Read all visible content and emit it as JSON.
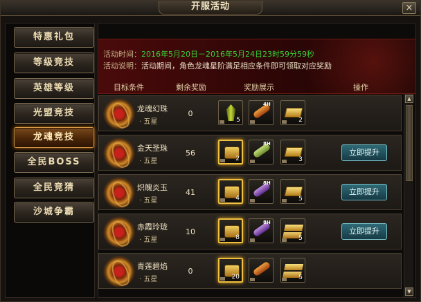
{
  "window": {
    "title": "开服活动",
    "close_glyph": "×"
  },
  "tabs": [
    {
      "id": "special-gift",
      "label": "特惠礼包",
      "active": false
    },
    {
      "id": "level-race",
      "label": "等级竞技",
      "active": false
    },
    {
      "id": "hero-level",
      "label": "英雄等级",
      "active": false
    },
    {
      "id": "alliance-race",
      "label": "光盟竞技",
      "active": false
    },
    {
      "id": "dragon-soul",
      "label": "龙魂竞技",
      "active": true
    },
    {
      "id": "all-boss",
      "label": "全民BOSS",
      "active": false
    },
    {
      "id": "all-guess",
      "label": "全民竞猜",
      "active": false
    },
    {
      "id": "city-war",
      "label": "沙城争霸",
      "active": false
    }
  ],
  "info": {
    "time_label": "活动时间：",
    "time_value": "2016年5月20日－2016年5月24日23时59分59秒",
    "desc_label": "活动说明：",
    "desc_value": "活动期间，角色龙魂星阶满足相应条件即可领取对应奖励"
  },
  "columns": {
    "target": "目标条件",
    "remain": "剩余奖励",
    "rewards": "奖励展示",
    "action": "操作"
  },
  "rows": [
    {
      "name": "龙魂幻珠",
      "star": "· 五星",
      "remain": "0",
      "rewards": [
        {
          "icon": "crystal-icon",
          "count": "5",
          "gold": false
        },
        {
          "icon": "scroll-orange-icon",
          "badge": "4H",
          "gold": false
        },
        {
          "icon": "gold-bar-icon",
          "count": "2",
          "gold": false
        }
      ],
      "button": null
    },
    {
      "name": "金天圣珠",
      "star": "· 五星",
      "remain": "56",
      "rewards": [
        {
          "icon": "gold-chest-icon",
          "count": "2",
          "gold": true
        },
        {
          "icon": "scroll-green-icon",
          "badge": "8H",
          "gold": false
        },
        {
          "icon": "gold-bar-icon",
          "count": "3",
          "gold": false
        }
      ],
      "button": "立即提升"
    },
    {
      "name": "炽魄炎玉",
      "star": "· 五星",
      "remain": "41",
      "rewards": [
        {
          "icon": "gold-chest-icon",
          "count": "4",
          "gold": true
        },
        {
          "icon": "scroll-purple-icon",
          "badge": "8H",
          "gold": false
        },
        {
          "icon": "gold-bar-icon",
          "count": "5",
          "gold": false
        }
      ],
      "button": "立即提升"
    },
    {
      "name": "赤霞玲珑",
      "star": "· 五星",
      "remain": "10",
      "rewards": [
        {
          "icon": "gold-chest-icon",
          "count": "8",
          "gold": true
        },
        {
          "icon": "scroll-purple-icon",
          "badge": "8H",
          "gold": false
        },
        {
          "icon": "gold-bars-icon",
          "count": "5",
          "gold": false
        }
      ],
      "button": "立即提升"
    },
    {
      "name": "青莲碧焰",
      "star": "· 五星",
      "remain": "0",
      "rewards": [
        {
          "icon": "gold-chest-icon",
          "count": "20",
          "gold": true
        },
        {
          "icon": "scroll-orange-icon",
          "badge": "",
          "gold": false
        },
        {
          "icon": "gold-bars-icon",
          "count": "5",
          "gold": false
        }
      ],
      "button": null
    }
  ],
  "scrollbar": {
    "up_glyph": "▲",
    "down_glyph": "▼"
  }
}
